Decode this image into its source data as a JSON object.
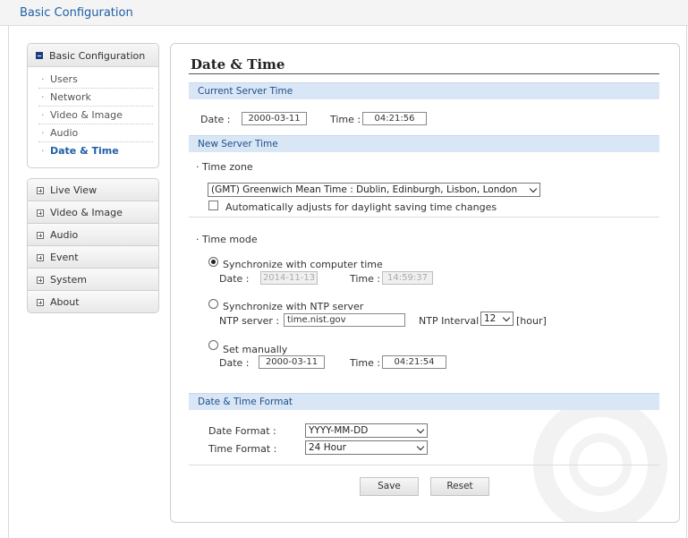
{
  "header": {
    "title": "Basic Configuration"
  },
  "sidebar": {
    "group": {
      "label": "Basic Configuration",
      "items": [
        "Users",
        "Network",
        "Video & Image",
        "Audio",
        "Date & Time"
      ],
      "bullet": "·"
    },
    "nav": [
      "Live View",
      "Video & Image",
      "Audio",
      "Event",
      "System",
      "About"
    ]
  },
  "main": {
    "title": "Date & Time",
    "current": {
      "section": "Current Server Time",
      "date_label": "Date :",
      "date": "2000-03-11",
      "time_label": "Time :",
      "time": "04:21:56"
    },
    "new": {
      "section": "New Server Time",
      "timezone_label": "· Time zone",
      "timezone_value": "(GMT) Greenwich Mean Time : Dublin, Edinburgh, Lisbon, London",
      "dst_label": "Automatically adjusts for daylight saving time changes",
      "mode_label": "· Time mode",
      "sync_pc_label": "Synchronize with computer time",
      "sync_pc_date_label": "Date :",
      "sync_pc_date": "2014-11-13",
      "sync_pc_time_label": "Time :",
      "sync_pc_time": "14:59:37",
      "ntp_label": "Synchronize with NTP server",
      "ntp_server_label": "NTP server :",
      "ntp_server": "time.nist.gov",
      "ntp_interval_label": "NTP Interval :",
      "ntp_interval": "12",
      "ntp_unit": "[hour]",
      "manual_label": "Set manually",
      "manual_date_label": "Date :",
      "manual_date": "2000-03-11",
      "manual_time_label": "Time :",
      "manual_time": "04:21:54"
    },
    "format": {
      "section": "Date & Time Format",
      "date_format_label": "Date Format :",
      "date_format": "YYYY-MM-DD",
      "time_format_label": "Time Format :",
      "time_format": "24 Hour"
    },
    "buttons": {
      "save": "Save",
      "reset": "Reset"
    }
  }
}
